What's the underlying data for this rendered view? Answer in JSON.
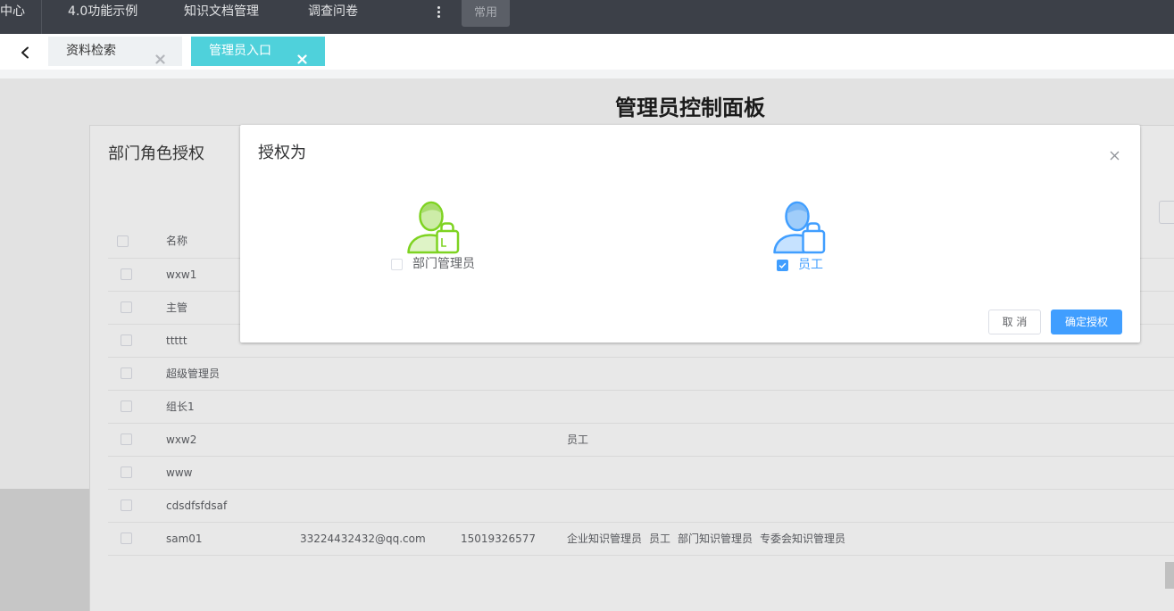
{
  "colors": {
    "nav_bg": "#3c4048",
    "tab_active": "#4fd1db",
    "accent": "#409eff",
    "role_green": "#7ed321"
  },
  "nav": {
    "items": [
      "中心",
      "4.0功能示例",
      "知识文档管理",
      "调查问卷"
    ],
    "more_icon": "more-vertical-icon",
    "common_label": "常用"
  },
  "tabs": {
    "back_icon": "chevron-left-icon",
    "items": [
      {
        "label": "资料检索",
        "active": false,
        "close_icon": "close-icon"
      },
      {
        "label": "管理员入口",
        "active": true,
        "close_icon": "close-icon"
      }
    ]
  },
  "page": {
    "title": "管理员控制面板",
    "panel_title": "部门角色授权",
    "table": {
      "headers": {
        "name": "名称"
      },
      "rows": [
        {
          "name": "wxw1"
        },
        {
          "name": "主管"
        },
        {
          "name": "ttttt"
        },
        {
          "name": "超级管理员"
        },
        {
          "name": "组长1"
        },
        {
          "name": "wxw2",
          "roles": [
            "员工"
          ]
        },
        {
          "name": "www"
        },
        {
          "name": "cdsdfsfdsaf"
        },
        {
          "name": "sam01",
          "email": "33224432432@qq.com",
          "phone": "15019326577",
          "roles": [
            "企业知识管理员",
            "员工",
            "部门知识管理员",
            "专委会知识管理员"
          ]
        }
      ]
    }
  },
  "modal": {
    "title": "授权为",
    "close_icon": "close-icon",
    "options": [
      {
        "label": "部门管理员",
        "checked": false,
        "icon": "user-briefcase-icon"
      },
      {
        "label": "员工",
        "checked": true,
        "icon": "user-briefcase-icon"
      }
    ],
    "cancel_label": "取 消",
    "confirm_label": "确定授权"
  }
}
